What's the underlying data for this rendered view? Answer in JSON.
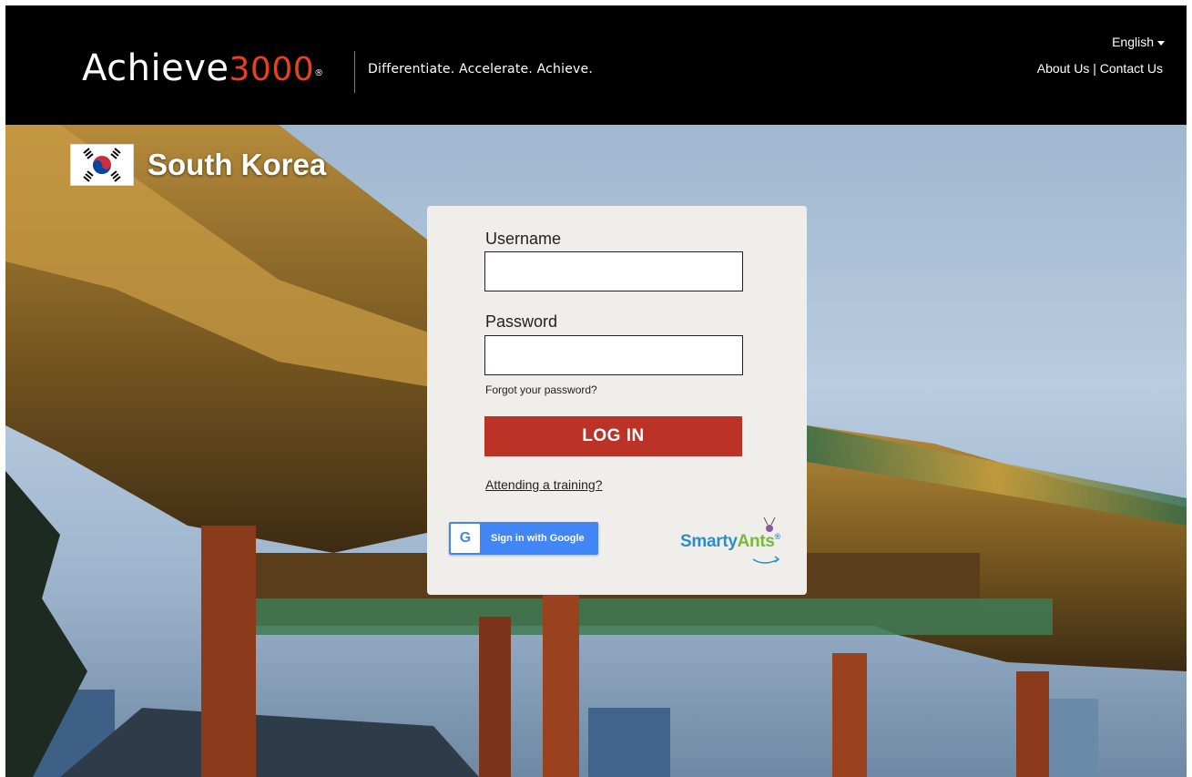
{
  "header": {
    "logo_word": "Achieve",
    "logo_number": "3000",
    "logo_mark": "®",
    "tagline": "Differentiate. Accelerate. Achieve.",
    "language": "English",
    "about_link": "About Us",
    "separator": "|",
    "contact_link": "Contact Us"
  },
  "hero": {
    "country_name": "South Korea",
    "flag_icon": "south-korea-flag-icon"
  },
  "login": {
    "username_label": "Username",
    "username_value": "",
    "password_label": "Password",
    "password_value": "",
    "forgot_link": "Forgot your password?",
    "login_button": "LOG IN",
    "training_link": "Attending a training?",
    "google_button": "Sign in with Google",
    "google_icon": "G",
    "smarty_part1": "Smarty",
    "smarty_part2": "Ants",
    "smarty_mark": "®"
  },
  "colors": {
    "header_bg": "#000000",
    "logo_accent": "#e8411f",
    "login_button_bg": "#bb3226",
    "card_bg": "#f0eeeb",
    "google_blue": "#4285f4",
    "smarty_blue": "#2d8ec7",
    "smarty_green": "#79b93a"
  }
}
